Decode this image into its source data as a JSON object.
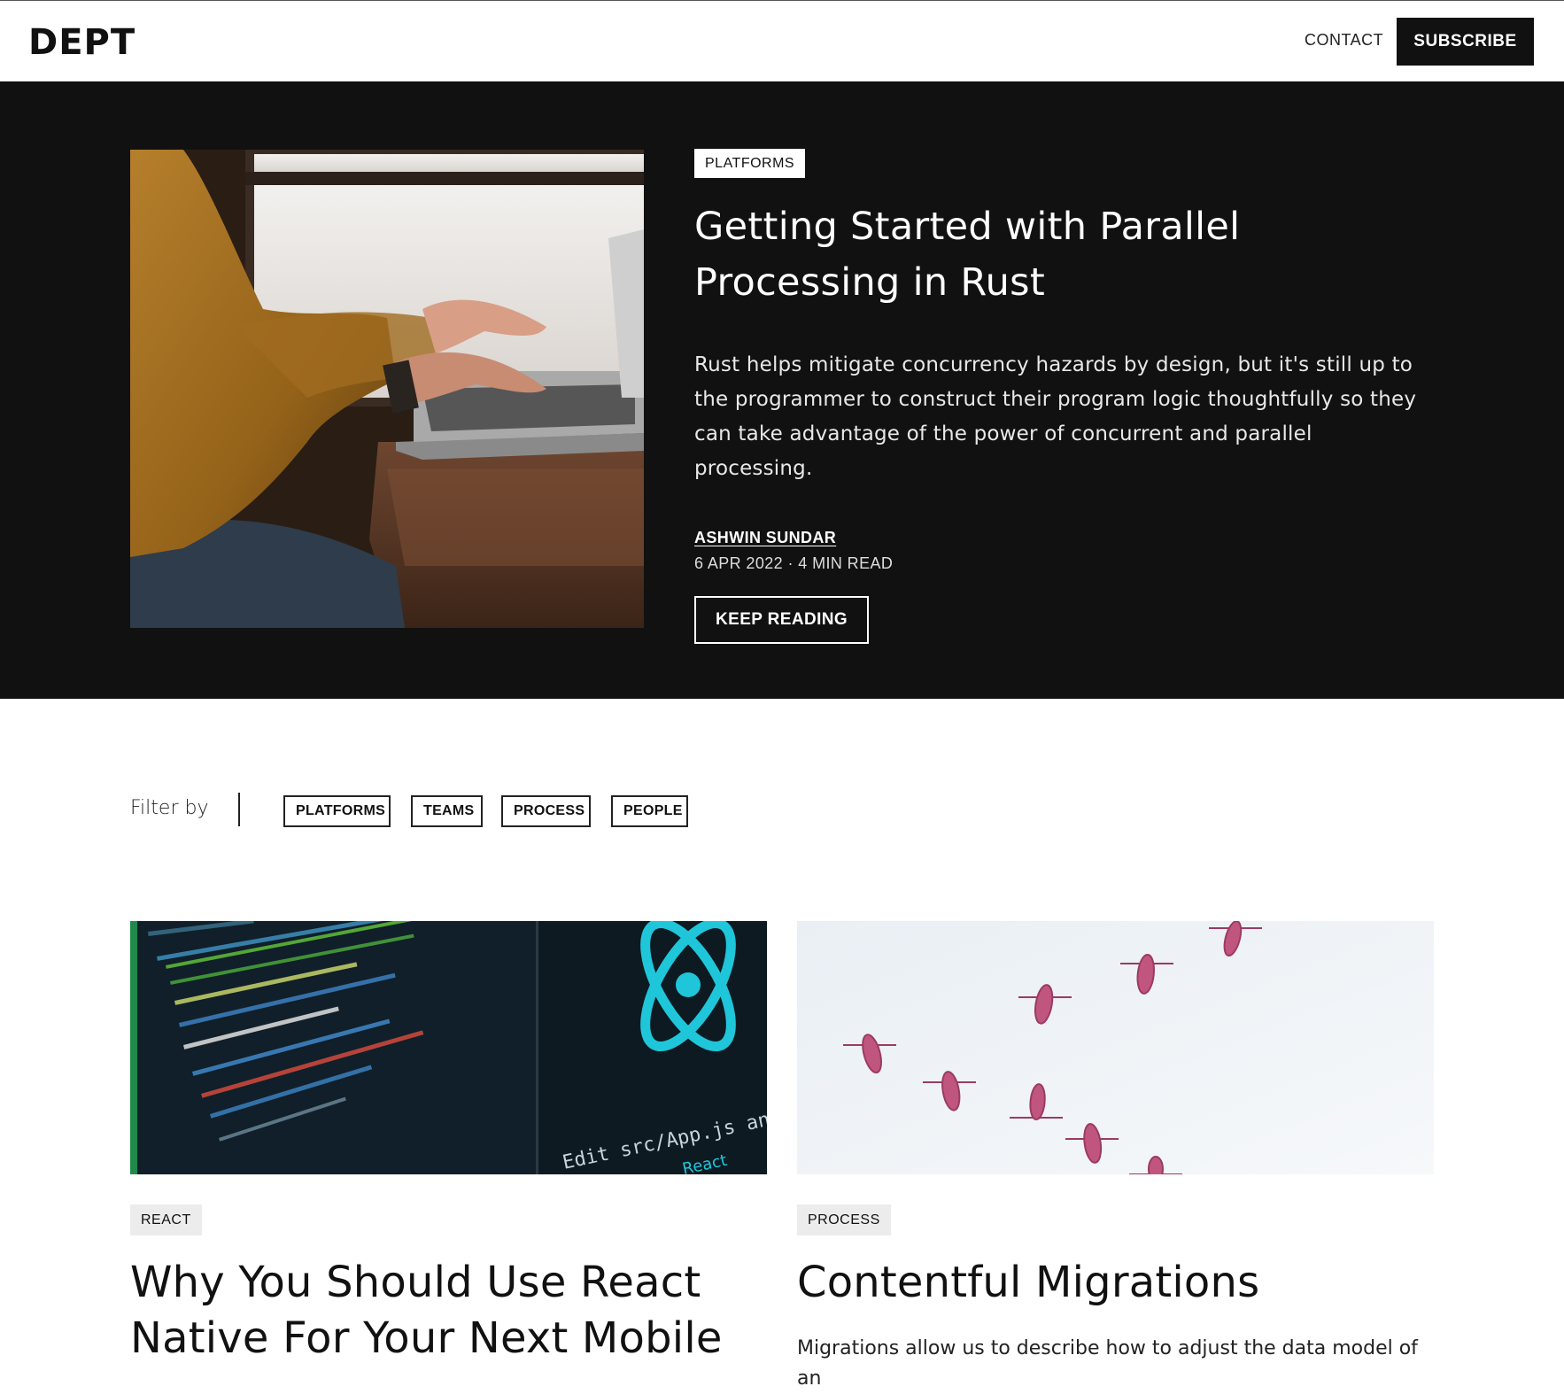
{
  "header": {
    "logo": "DEPT",
    "contact_label": "CONTACT",
    "subscribe_label": "SUBSCRIBE"
  },
  "hero": {
    "tag": "PLATFORMS",
    "title": "Getting Started with Parallel Processing in Rust",
    "description": "Rust helps mitigate concurrency hazards by design, but it's still up to the programmer to construct their program logic thoughtfully so they can take advantage of the power of concurrent and parallel processing.",
    "author": "ASHWIN SUNDAR",
    "meta": "6 APR 2022 · 4 MIN READ",
    "cta_label": "KEEP READING",
    "image_alt": "Person typing on a laptop"
  },
  "filter": {
    "label": "Filter by",
    "chips": [
      "PLATFORMS",
      "TEAMS",
      "PROCESS",
      "PEOPLE"
    ]
  },
  "cards": [
    {
      "tag": "REACT",
      "title": "Why You Should Use React Native For Your Next Mobile",
      "description": "",
      "image_caption": "Edit src/App.js and save to rel",
      "image_caption_2": "React"
    },
    {
      "tag": "PROCESS",
      "title": "Contentful Migrations",
      "description": "Migrations allow us to describe how to adjust the data model of an"
    }
  ],
  "colors": {
    "hero_bg": "#111111",
    "react_cyan": "#1fc6d9",
    "bird_pink": "#c0567e",
    "sky": "#eef3f7"
  }
}
